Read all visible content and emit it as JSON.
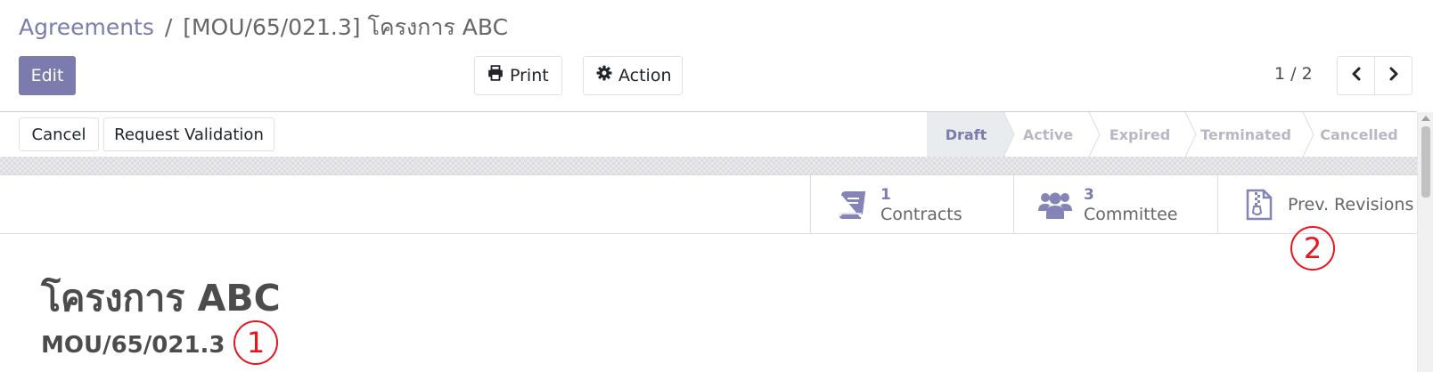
{
  "breadcrumb": {
    "parent": "Agreements",
    "separator": "/",
    "current": "[MOU/65/021.3] โครงการ ABC"
  },
  "toolbar": {
    "edit_label": "Edit",
    "print_label": "Print",
    "action_label": "Action"
  },
  "pager": {
    "value": "1 / 2"
  },
  "status_buttons": {
    "cancel_label": "Cancel",
    "request_label": "Request Validation"
  },
  "stages": {
    "draft": "Draft",
    "active": "Active",
    "expired": "Expired",
    "terminated": "Terminated",
    "cancelled": "Cancelled",
    "current": "Draft"
  },
  "smart_buttons": {
    "contracts": {
      "count": "1",
      "label": "Contracts"
    },
    "committee": {
      "count": "3",
      "label": "Committee"
    },
    "revisions": {
      "label": "Prev. Revisions"
    }
  },
  "record": {
    "title": "โครงการ ABC",
    "code": "MOU/65/021.3"
  },
  "annotations": {
    "marker_1": "1",
    "marker_2": "2"
  },
  "colors": {
    "brand": "#7c7bad",
    "annotation": "#e8141e"
  }
}
